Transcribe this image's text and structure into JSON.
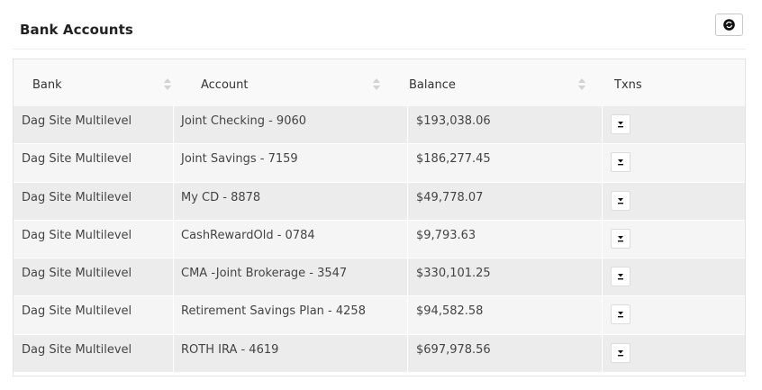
{
  "panel": {
    "title": "Bank Accounts",
    "refresh_icon": "refresh-icon"
  },
  "table": {
    "columns": [
      {
        "label": "Bank",
        "sortable": true
      },
      {
        "label": "Account",
        "sortable": true
      },
      {
        "label": "Balance",
        "sortable": true
      },
      {
        "label": "Txns",
        "sortable": false
      }
    ],
    "rows": [
      {
        "bank": "Dag Site Multilevel",
        "account": "Joint Checking - 9060",
        "balance": "$193,038.06"
      },
      {
        "bank": "Dag Site Multilevel",
        "account": "Joint Savings - 7159",
        "balance": "$186,277.45"
      },
      {
        "bank": "Dag Site Multilevel",
        "account": "My CD - 8878",
        "balance": "$49,778.07"
      },
      {
        "bank": "Dag Site Multilevel",
        "account": "CashRewardOld - 0784",
        "balance": "$9,793.63"
      },
      {
        "bank": "Dag Site Multilevel",
        "account": "CMA -Joint Brokerage - 3547",
        "balance": "$330,101.25"
      },
      {
        "bank": "Dag Site Multilevel",
        "account": "Retirement Savings Plan - 4258",
        "balance": "$94,582.58"
      },
      {
        "bank": "Dag Site Multilevel",
        "account": "ROTH IRA - 4619",
        "balance": "$697,978.56"
      }
    ],
    "txns_icon": "download-icon"
  },
  "colors": {
    "row_odd": "#ececec",
    "row_even": "#f5f5f5",
    "header_bg": "#f9f9f9",
    "text": "#333333"
  }
}
